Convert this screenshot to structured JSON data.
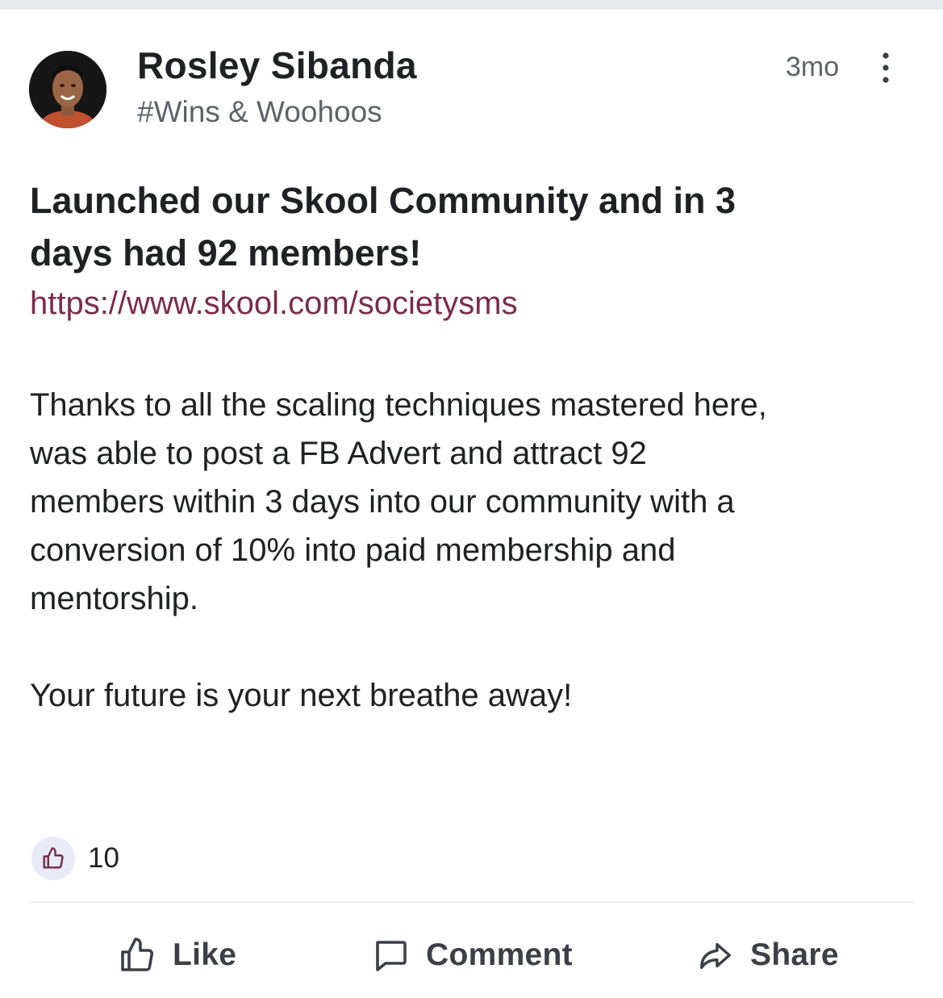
{
  "post": {
    "author": "Rosley Sibanda",
    "category": "#Wins & Woohoos",
    "time": "3mo",
    "title_line1": "Launched our Skool Community and in 3",
    "title_line2": "days had 92 members!",
    "link": "https://www.skool.com/societysms",
    "body_line1": "Thanks to all the scaling techniques mastered here,",
    "body_line2": "was able to post a FB Advert and attract 92",
    "body_line3": "members within 3 days into our community with a",
    "body_line4": "conversion of 10% into paid membership and",
    "body_line5": "mentorship.",
    "closing": "Your future is your next breathe away!",
    "like_count": "10"
  },
  "actions": {
    "like": "Like",
    "comment": "Comment",
    "share": "Share"
  },
  "colors": {
    "link": "#7b2c4a",
    "like_badge_bg": "#e8eaf6",
    "like_icon": "#7b2c4a",
    "muted_text": "#5f6368"
  },
  "icons": {
    "more": "vertical-ellipsis-icon",
    "like_badge": "thumbs-up-icon",
    "like_action": "thumbs-up-outline-icon",
    "comment_action": "speech-bubble-icon",
    "share_action": "share-arrow-icon"
  }
}
